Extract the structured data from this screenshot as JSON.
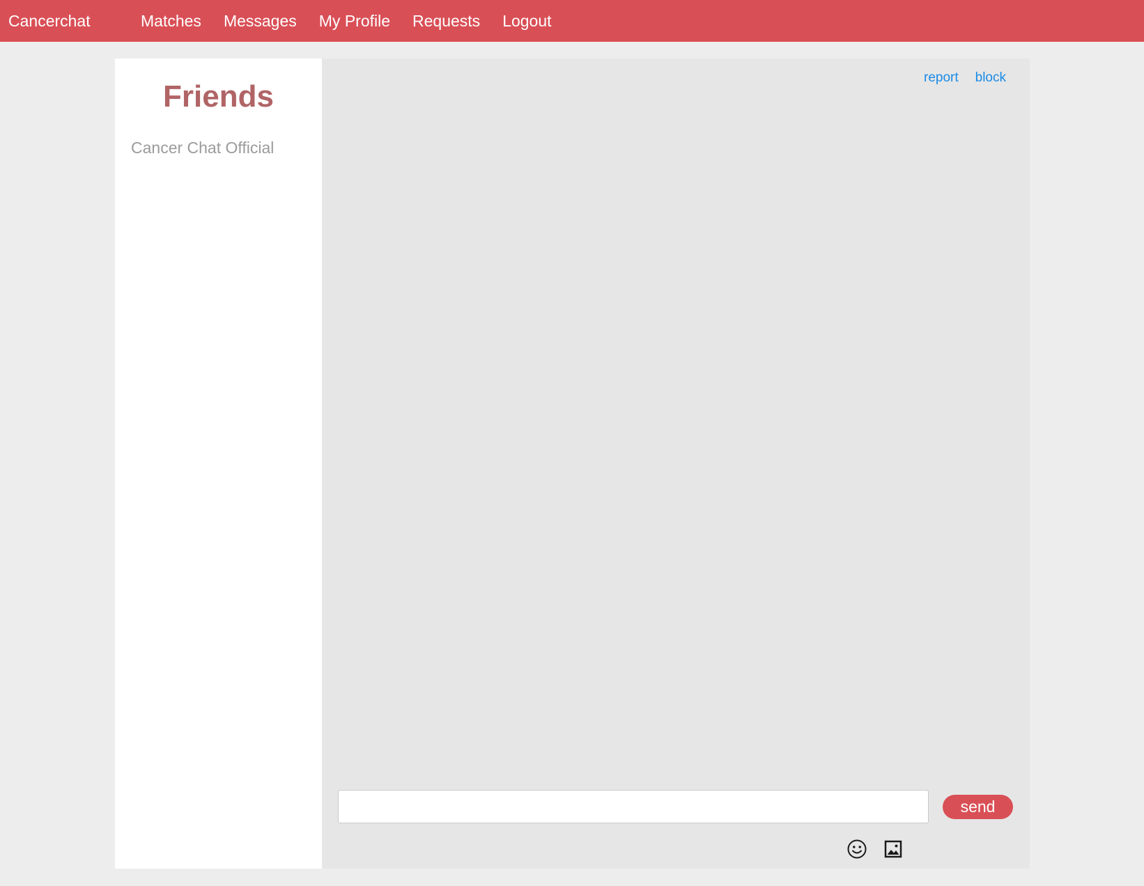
{
  "navbar": {
    "brand": "Cancerchat",
    "links": [
      "Matches",
      "Messages",
      "My Profile",
      "Requests",
      "Logout"
    ],
    "color": "#d94f56"
  },
  "sidebar": {
    "title": "Friends",
    "friends": [
      "Cancer Chat Official"
    ]
  },
  "chat": {
    "actions": {
      "report": "report",
      "block": "block"
    },
    "input": {
      "value": "",
      "placeholder": ""
    },
    "send_label": "send",
    "icons": [
      "smiley-icon",
      "image-icon"
    ]
  }
}
